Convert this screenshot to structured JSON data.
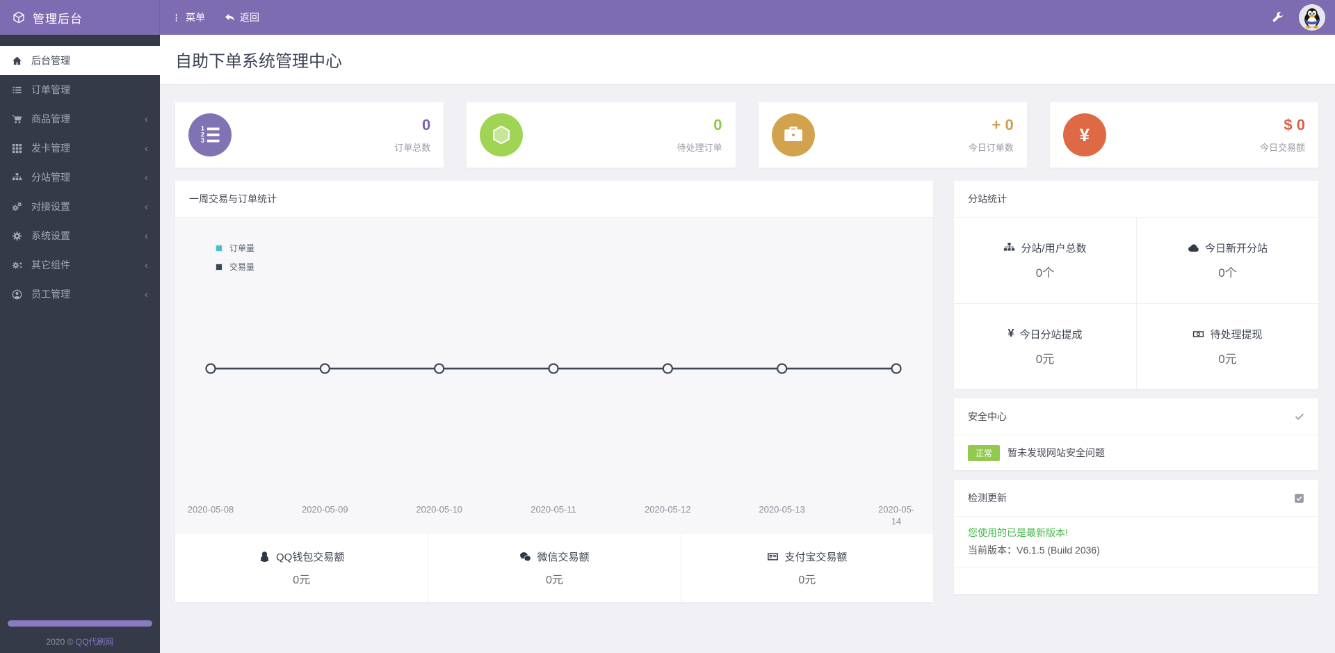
{
  "topbar": {
    "brand": "管理后台",
    "menu_label": "菜单",
    "back_label": "返回"
  },
  "sidebar": {
    "items": [
      {
        "label": "后台管理",
        "icon": "home",
        "active": true,
        "has_submenu": false
      },
      {
        "label": "订单管理",
        "icon": "list",
        "active": false,
        "has_submenu": false
      },
      {
        "label": "商品管理",
        "icon": "shopping-cart",
        "active": false,
        "has_submenu": true
      },
      {
        "label": "发卡管理",
        "icon": "grid",
        "active": false,
        "has_submenu": true
      },
      {
        "label": "分站管理",
        "icon": "sitemap",
        "active": false,
        "has_submenu": true
      },
      {
        "label": "对接设置",
        "icon": "cogs",
        "active": false,
        "has_submenu": true
      },
      {
        "label": "系统设置",
        "icon": "gear",
        "active": false,
        "has_submenu": true
      },
      {
        "label": "其它组件",
        "icon": "components",
        "active": false,
        "has_submenu": true
      },
      {
        "label": "员工管理",
        "icon": "user",
        "active": false,
        "has_submenu": true
      }
    ],
    "footer": {
      "year_text": "2020 ©",
      "site_link": "QQ代刷网"
    }
  },
  "page": {
    "title": "自助下单系统管理中心"
  },
  "stats": [
    {
      "value": "0",
      "label": "订单总数",
      "icon": "ordered-list-icon",
      "color": "#8172b4",
      "value_color": "#7a5fb0"
    },
    {
      "value": "0",
      "label": "待处理订单",
      "icon": "hexagon-icon",
      "color": "#a0d455",
      "value_color": "#8fc843"
    },
    {
      "value": "+ 0",
      "label": "今日订单数",
      "icon": "briefcase-icon",
      "color": "#d2a24c",
      "value_color": "#cfa04a"
    },
    {
      "value": "$ 0",
      "label": "今日交易额",
      "icon": "yen-icon",
      "icon_char": "¥",
      "color": "#dd6a45",
      "value_color": "#dd5f45"
    }
  ],
  "weekly_panel": {
    "title": "一周交易与订单统计",
    "chart_data": {
      "type": "line",
      "categories": [
        "2020-05-08",
        "2020-05-09",
        "2020-05-10",
        "2020-05-11",
        "2020-05-12",
        "2020-05-13",
        "2020-05-14"
      ],
      "series": [
        {
          "name": "订单量",
          "color": "#48bcd3",
          "values": [
            0,
            0,
            0,
            0,
            0,
            0,
            0
          ]
        },
        {
          "name": "交易量",
          "color": "#3e4554",
          "values": [
            0,
            0,
            0,
            0,
            0,
            0,
            0
          ]
        }
      ],
      "legend_position": "top-left",
      "grid": false,
      "ylim": [
        0,
        1
      ]
    },
    "footer_stats": [
      {
        "icon": "qq-icon",
        "label": "QQ钱包交易额",
        "value": "0元"
      },
      {
        "icon": "wechat-icon",
        "label": "微信交易额",
        "value": "0元"
      },
      {
        "icon": "credit-card-icon",
        "label": "支付宝交易额",
        "value": "0元"
      }
    ]
  },
  "substation_panel": {
    "title": "分站统计",
    "cells": [
      {
        "icon": "sitemap-icon",
        "label": "分站/用户总数",
        "value": "0个"
      },
      {
        "icon": "cloud-icon",
        "label": "今日新开分站",
        "value": "0个"
      },
      {
        "icon": "yen-icon",
        "icon_char": "¥",
        "label": "今日分站提成",
        "value": "0元"
      },
      {
        "icon": "money-icon",
        "label": "待处理提现",
        "value": "0元"
      }
    ]
  },
  "security_panel": {
    "title": "安全中心",
    "badge": "正常",
    "message": "暂未发现网站安全问题"
  },
  "update_panel": {
    "title": "检测更新",
    "status_line": "您使用的已是最新版本!",
    "version_line": "当前版本：V6.1.5 (Build 2036)"
  },
  "colors": {
    "topbar_purple": "#7d6cb2",
    "sidebar_dark": "#343a47",
    "badge_green": "#92c94e",
    "update_ok_green": "#44b549",
    "chart_line": "#3e4554",
    "legend_cyan": "#48bcd3",
    "legend_dark": "#3e4554",
    "sidebar_deco_purple": "#8a7ac2"
  }
}
